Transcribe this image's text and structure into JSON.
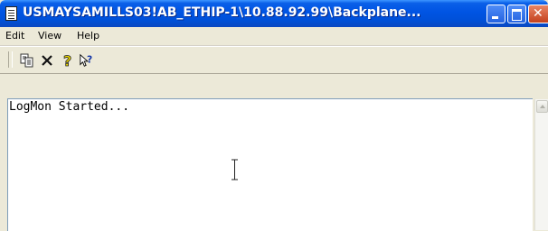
{
  "window": {
    "title": "USMAYSAMILLS03!AB_ETHIP-1\\10.88.92.99\\Backplane..."
  },
  "menu": {
    "items": [
      {
        "label": "Edit"
      },
      {
        "label": "View"
      },
      {
        "label": "Help"
      }
    ]
  },
  "toolbar": {
    "icons": [
      "copy-icon",
      "clear-icon",
      "help-icon",
      "context-help-icon"
    ]
  },
  "log": {
    "lines": [
      "LogMon Started..."
    ]
  },
  "colors": {
    "titlebar": "#0054e3",
    "close_button": "#d6522e",
    "content_bg": "#ffffff"
  }
}
